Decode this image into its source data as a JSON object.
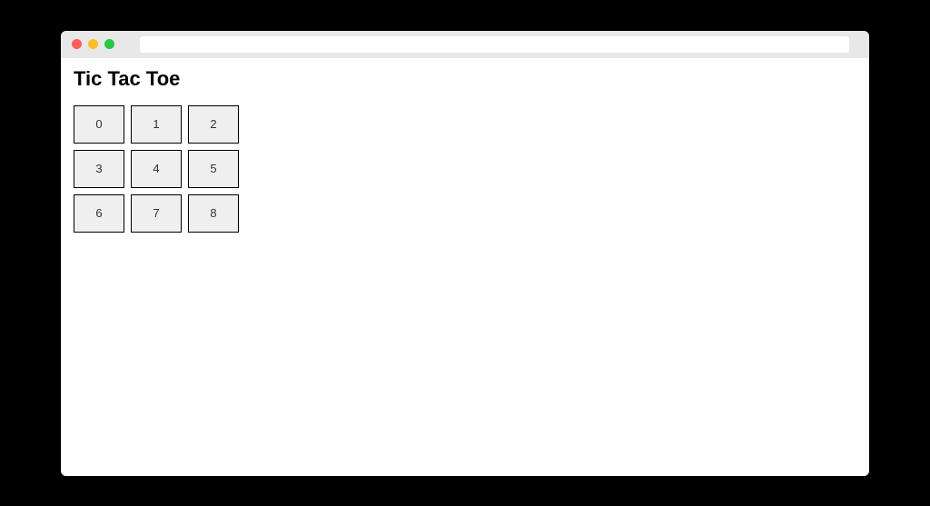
{
  "page": {
    "title": "Tic Tac Toe"
  },
  "board": {
    "cells": [
      "0",
      "1",
      "2",
      "3",
      "4",
      "5",
      "6",
      "7",
      "8"
    ]
  }
}
